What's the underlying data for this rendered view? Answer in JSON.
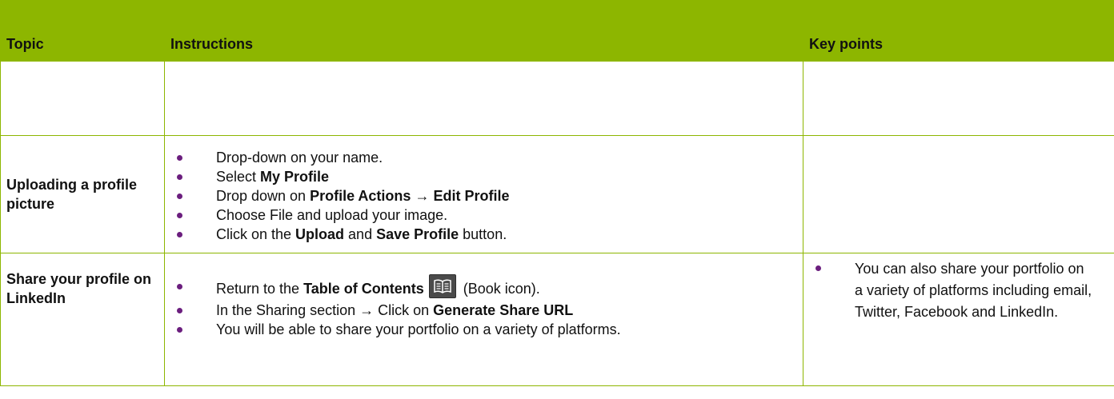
{
  "header": {
    "topic": "Topic",
    "instructions": "Instructions",
    "key_points": "Key points"
  },
  "rows": [
    {
      "topic": "",
      "instructions": [],
      "key_points": []
    },
    {
      "topic": "Uploading a profile picture",
      "instructions": [
        {
          "text": "Drop-down on your name."
        },
        {
          "pre": "Select ",
          "b1": "My Profile"
        },
        {
          "pre": "Drop down on ",
          "b1": "Profile Actions",
          "arrow": "→",
          "b2": "Edit Profile"
        },
        {
          "text": "Choose File and upload your image."
        },
        {
          "pre": "Click on the ",
          "b1": "Upload",
          "mid": " and ",
          "b2": "Save Profile",
          "post": " button."
        }
      ],
      "key_points": []
    },
    {
      "topic": "Share your profile on LinkedIn",
      "instructions": [
        {
          "pre": "Return to the ",
          "b1": "Table of Contents",
          "icon": "book-icon",
          "post": " (Book icon)."
        },
        {
          "pre": "In the Sharing section ",
          "arrow": "→",
          "mid": " Click on ",
          "b1": "Generate Share URL"
        },
        {
          "text": "You will be able to share your portfolio on a variety of platforms."
        }
      ],
      "key_points": [
        "You can also share your portfolio on a variety of platforms including email, Twitter, Facebook and LinkedIn."
      ]
    }
  ],
  "colors": {
    "header_green": "#8db600",
    "bullet_purple": "#6b1e7e"
  }
}
